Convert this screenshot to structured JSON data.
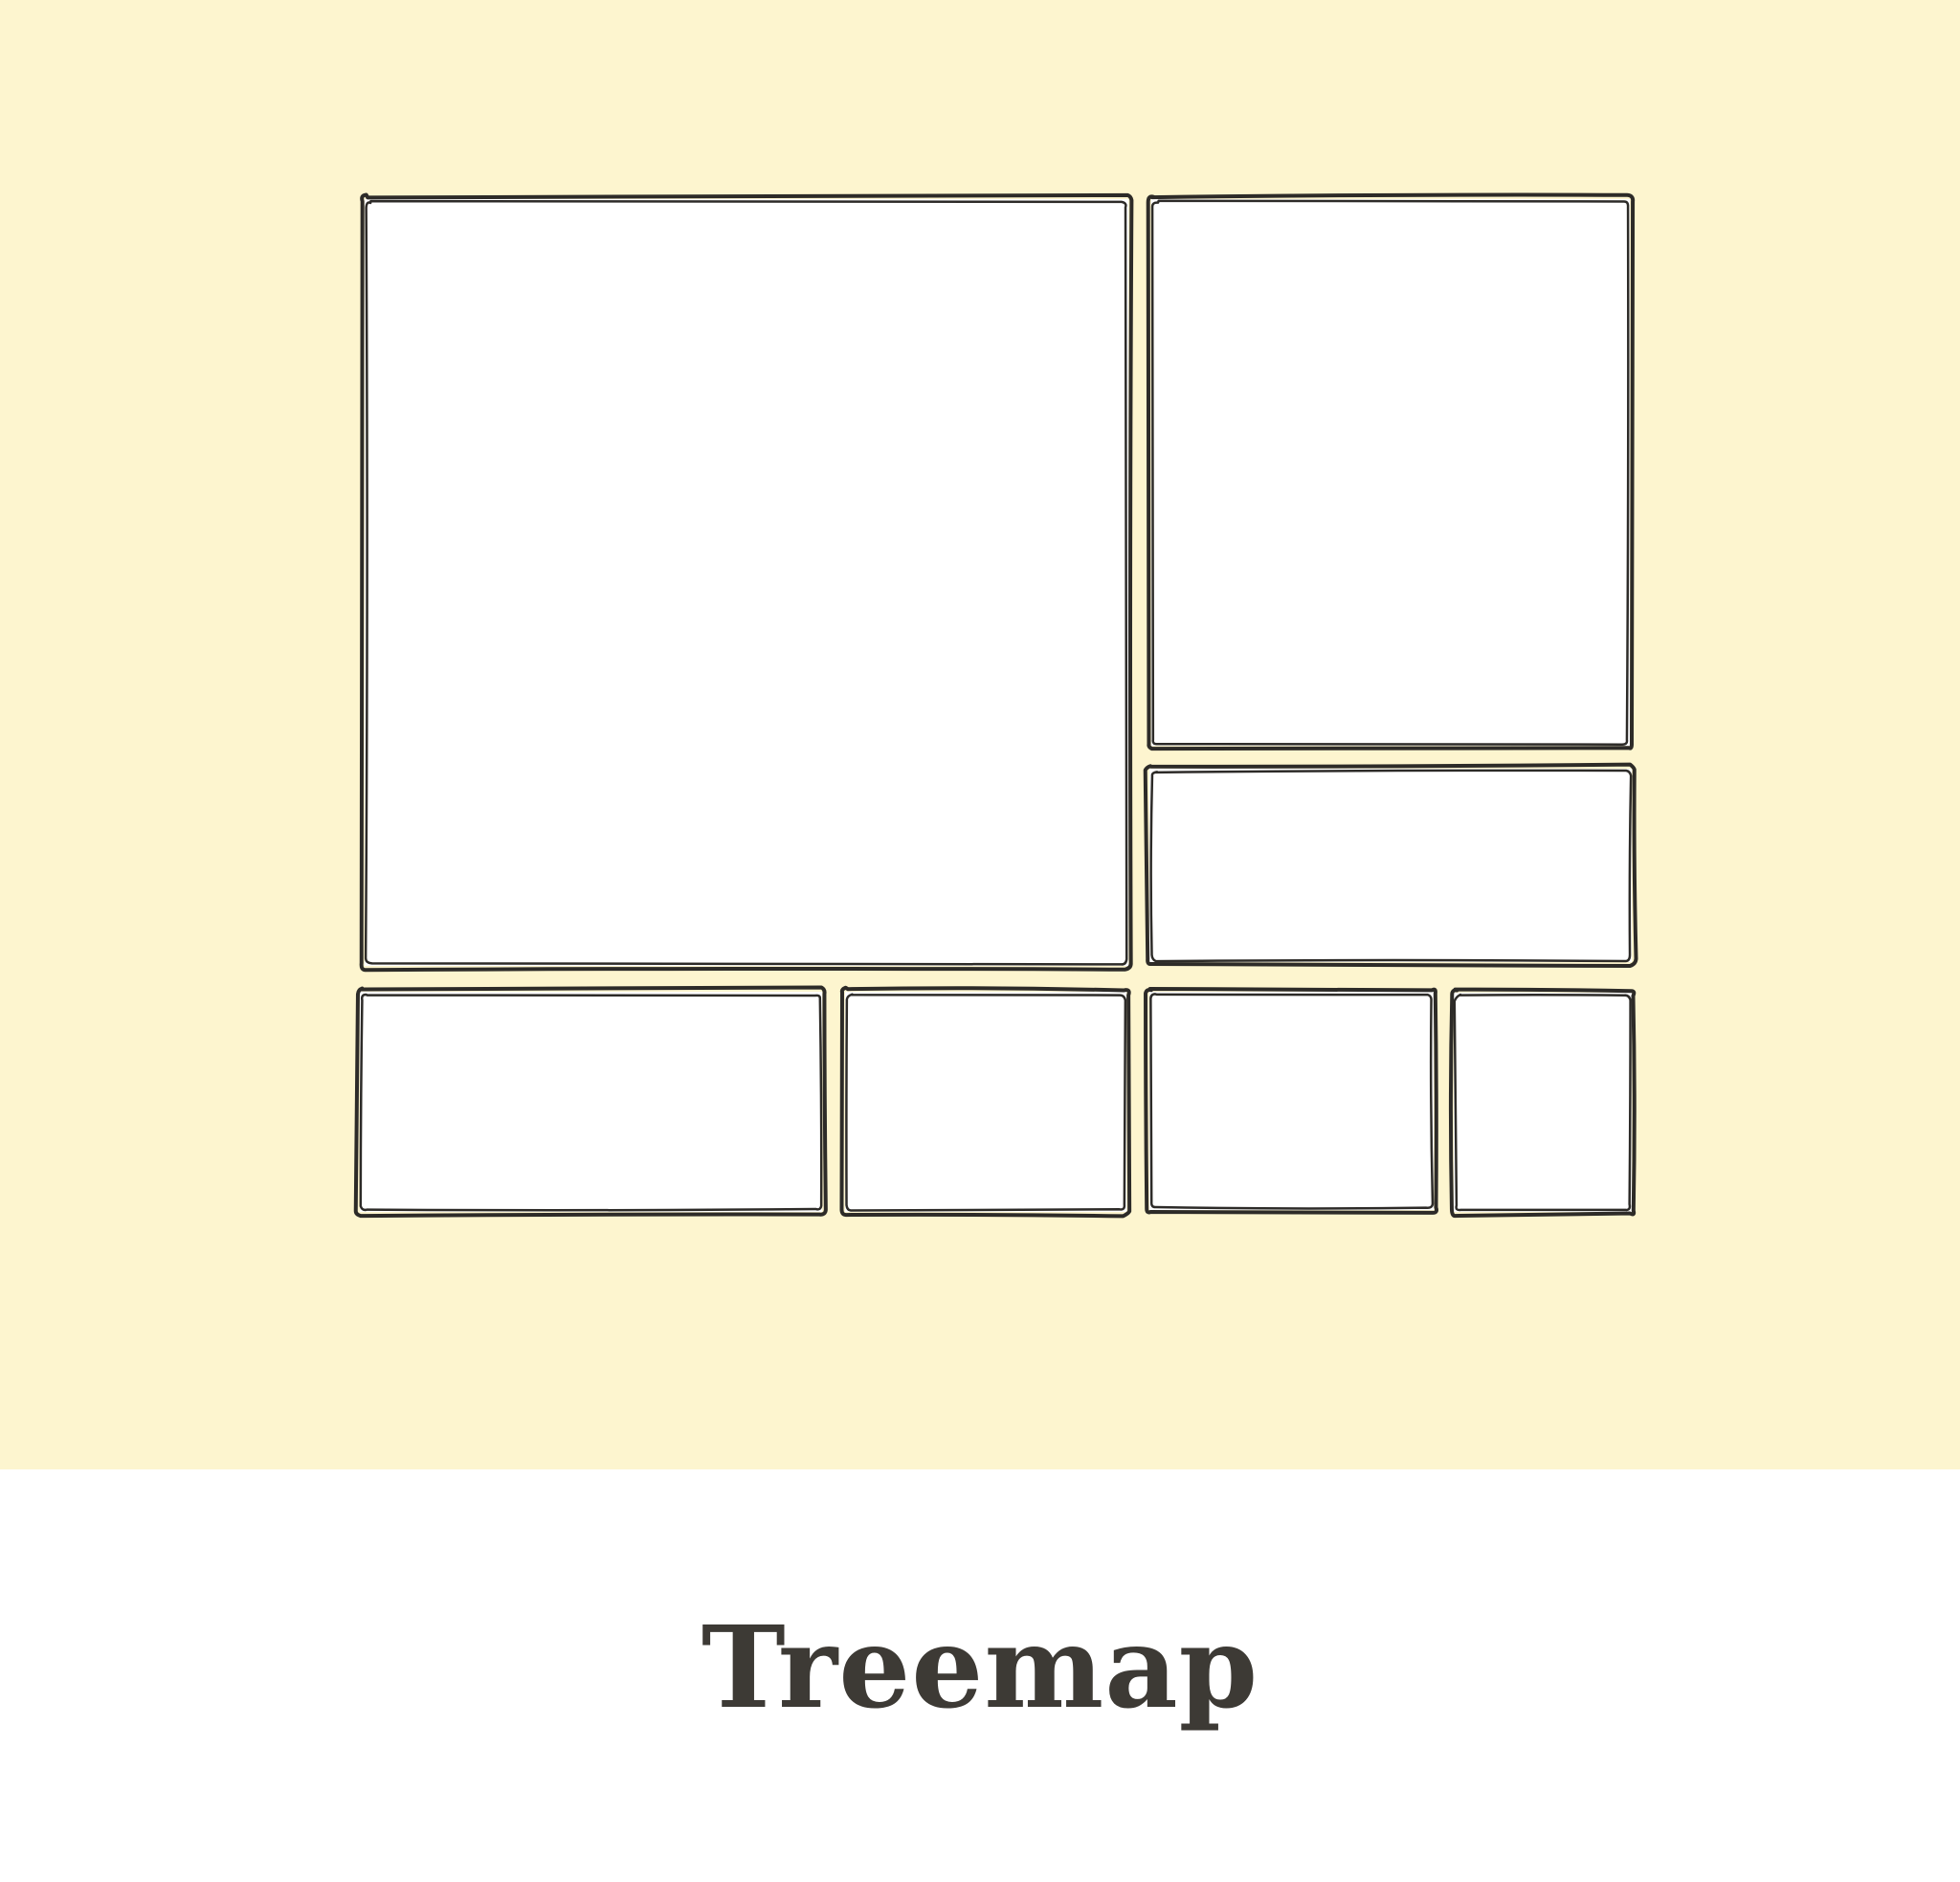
{
  "caption": "Treemap",
  "colors": {
    "background_panel": "#fdf5cf",
    "tile_fill": "#ffffff",
    "outline": "#2d2b28",
    "caption_text": "#3d3a35"
  }
}
